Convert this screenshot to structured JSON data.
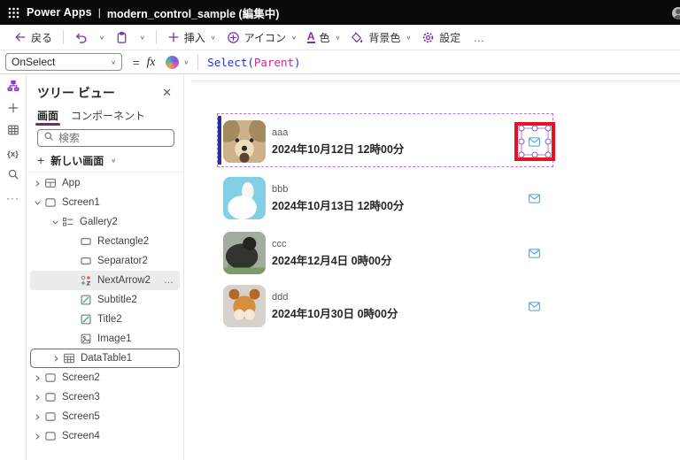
{
  "app_header": {
    "product": "Power Apps",
    "separator": "|",
    "document": "modern_control_sample (編集中)"
  },
  "toolbar": {
    "back_label": "戻る",
    "insert_label": "挿入",
    "icons_label": "アイコン",
    "color_label": "色",
    "color_glyph": "A",
    "bg_color_label": "背景色",
    "settings_label": "設定",
    "overflow_glyph": "…"
  },
  "formula_bar": {
    "property": "OnSelect",
    "equals": "=",
    "fx_label": "fx",
    "formula": {
      "fn": "Select(",
      "arg": "Parent",
      "close": ")"
    }
  },
  "left_rail": {
    "icons": [
      "tree-view-icon",
      "insert-icon",
      "data-icon",
      "variables-icon",
      "search-icon",
      "more-icon"
    ],
    "variables_glyph": "{x}",
    "more_glyph": "···"
  },
  "tree_panel": {
    "title": "ツリー ビュー",
    "close_glyph": "✕",
    "tabs": [
      {
        "label": "画面",
        "active": true
      },
      {
        "label": "コンポーネント",
        "active": false
      }
    ],
    "search_placeholder": "検索",
    "new_screen_plus": "+",
    "new_screen_label": "新しい画面",
    "overflow_glyph": "…",
    "items": [
      {
        "label": "App",
        "depth": 0,
        "chevron": "collapsed",
        "icon": "app"
      },
      {
        "label": "Screen1",
        "depth": 0,
        "chevron": "expanded",
        "icon": "screen"
      },
      {
        "label": "Gallery2",
        "depth": 1,
        "chevron": "expanded",
        "icon": "gallery"
      },
      {
        "label": "Rectangle2",
        "depth": 2,
        "chevron": null,
        "icon": "rect"
      },
      {
        "label": "Separator2",
        "depth": 2,
        "chevron": null,
        "icon": "rect"
      },
      {
        "label": "NextArrow2",
        "depth": 2,
        "chevron": null,
        "icon": "modern",
        "selected": true,
        "overflow": true
      },
      {
        "label": "Subtitle2",
        "depth": 2,
        "chevron": null,
        "icon": "label"
      },
      {
        "label": "Title2",
        "depth": 2,
        "chevron": null,
        "icon": "label"
      },
      {
        "label": "Image1",
        "depth": 2,
        "chevron": null,
        "icon": "image"
      },
      {
        "label": "DataTable1",
        "depth": 1,
        "chevron": "collapsed",
        "icon": "table",
        "outlined": true
      },
      {
        "label": "Screen2",
        "depth": 0,
        "chevron": "collapsed",
        "icon": "screen"
      },
      {
        "label": "Screen3",
        "depth": 0,
        "chevron": "collapsed",
        "icon": "screen"
      },
      {
        "label": "Screen5",
        "depth": 0,
        "chevron": "collapsed",
        "icon": "screen"
      },
      {
        "label": "Screen4",
        "depth": 0,
        "chevron": "collapsed",
        "icon": "screen"
      }
    ]
  },
  "canvas": {
    "gallery_items": [
      {
        "title": "aaa",
        "subtitle": "2024年10月12日 12時00分",
        "photo": "dog",
        "selected": true,
        "mail_highlighted": true
      },
      {
        "title": "bbb",
        "subtitle": "2024年10月13日 12時00分",
        "photo": "rabbit"
      },
      {
        "title": "ccc",
        "subtitle": "2024年12月4日 0時00分",
        "photo": "gorilla"
      },
      {
        "title": "ddd",
        "subtitle": "2024年10月30日 0時00分",
        "photo": "fox"
      }
    ]
  },
  "colors": {
    "topbar_bg": "#0a0a0a",
    "brand_purple": "#7a2fa8",
    "tab_underline": "#742774",
    "selection_dashed": "#b877cf",
    "selection_handles": "#8661c5",
    "gallery_indicator_navy": "#2f2d9e",
    "mail_blue": "#4a9de3",
    "highlight_red": "#e81123",
    "formula_fn": "#1e36cf",
    "formula_arg": "#bf2e8d",
    "label_icon_teal": "#45b5b0"
  }
}
